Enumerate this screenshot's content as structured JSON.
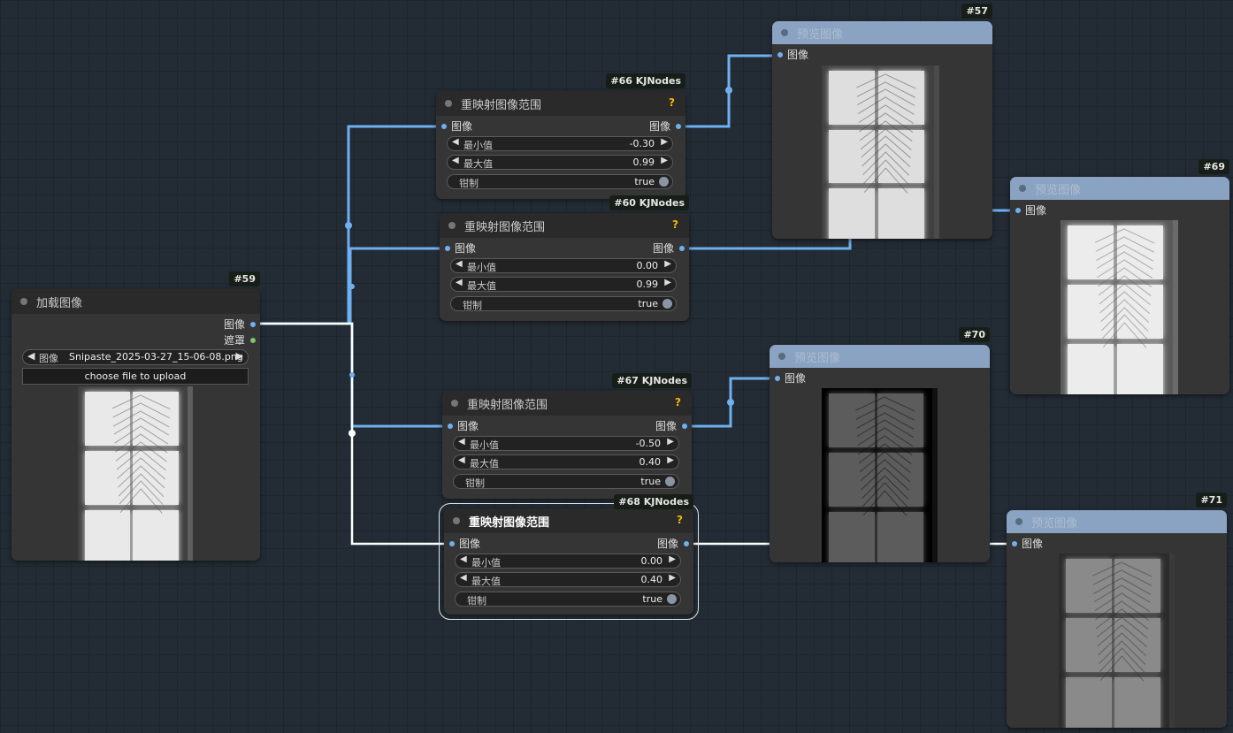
{
  "nodes": {
    "load": {
      "id": "#59",
      "title": "加载图像",
      "out_image": "图像",
      "out_mask": "遮罩",
      "widget_label": "图像",
      "file_name": "Snipaste_2025-03-27_15-06-08.png",
      "upload_label": "choose file to upload"
    },
    "n66": {
      "id": "#66 KJNodes",
      "title": "重映射图像范围",
      "help": "?",
      "in_image": "图像",
      "out_image": "图像",
      "min_label": "最小值",
      "min_value": "-0.30",
      "max_label": "最大值",
      "max_value": "0.99",
      "clamp_label": "钳制",
      "clamp_value": "true"
    },
    "n60": {
      "id": "#60 KJNodes",
      "title": "重映射图像范围",
      "help": "?",
      "in_image": "图像",
      "out_image": "图像",
      "min_label": "最小值",
      "min_value": "0.00",
      "max_label": "最大值",
      "max_value": "0.99",
      "clamp_label": "钳制",
      "clamp_value": "true"
    },
    "n67": {
      "id": "#67 KJNodes",
      "title": "重映射图像范围",
      "help": "?",
      "in_image": "图像",
      "out_image": "图像",
      "min_label": "最小值",
      "min_value": "-0.50",
      "max_label": "最大值",
      "max_value": "0.40",
      "clamp_label": "钳制",
      "clamp_value": "true"
    },
    "n68": {
      "id": "#68 KJNodes",
      "title": "重映射图像范围",
      "help": "?",
      "in_image": "图像",
      "out_image": "图像",
      "min_label": "最小值",
      "min_value": "0.00",
      "max_label": "最大值",
      "max_value": "0.40",
      "clamp_label": "钳制",
      "clamp_value": "true"
    },
    "p57": {
      "id": "#57",
      "title": "预览图像",
      "in_image": "图像"
    },
    "p69": {
      "id": "#69",
      "title": "预览图像",
      "in_image": "图像"
    },
    "p70": {
      "id": "#70",
      "title": "预览图像",
      "in_image": "图像"
    },
    "p71": {
      "id": "#71",
      "title": "预览图像",
      "in_image": "图像"
    }
  },
  "colors": {
    "canvas": "#232c35",
    "node": "#353535",
    "preview_header": "#8aa3c3",
    "image_link": "#6fb0f0",
    "selected_link": "#ffffff",
    "help": "#f5b800"
  }
}
